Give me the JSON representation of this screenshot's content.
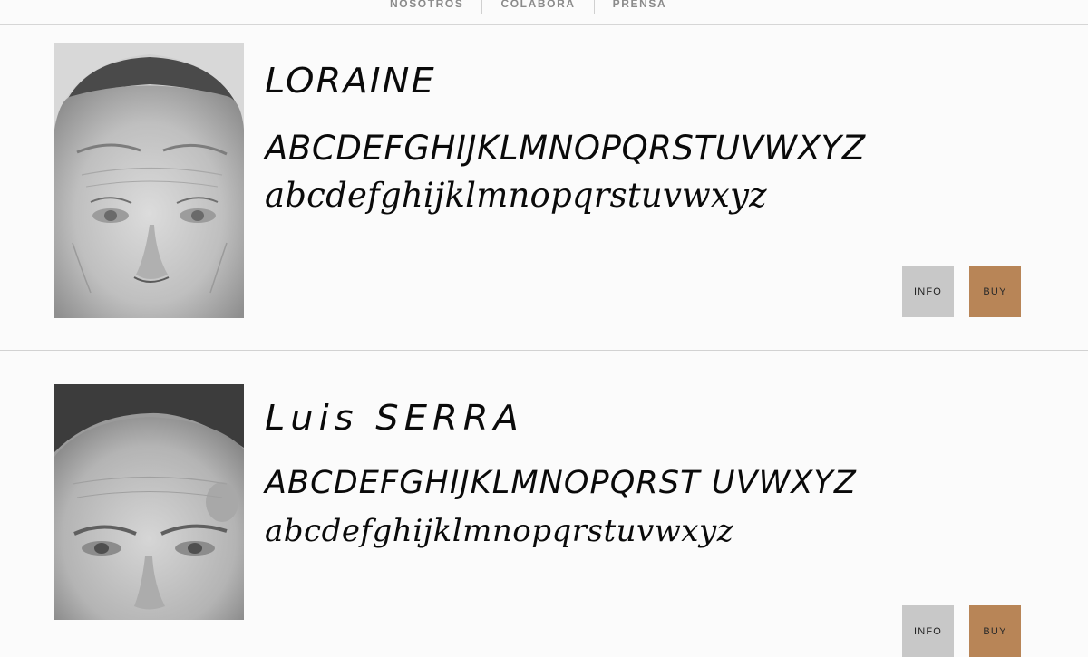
{
  "nav": {
    "items": [
      {
        "label": "NOSOTROS"
      },
      {
        "label": "COLABORA"
      },
      {
        "label": "PRENSA"
      }
    ]
  },
  "fonts": [
    {
      "name": "LORAINE",
      "uppercase": "ABCDEFGHIJKLMNOPQRSTUVWXYZ",
      "lowercase": "abcdefghijklmnopqrstuvwxyz",
      "info_label": "INFO",
      "buy_label": "BUY"
    },
    {
      "name": "Luis SERRA",
      "uppercase": "ABCDEFGHIJKLMNOPQRST UVWXYZ",
      "lowercase": "abcdefghijklmnopqrstuvwxyz",
      "info_label": "INFO",
      "buy_label": "BUY"
    }
  ],
  "colors": {
    "background": "#fbfbfb",
    "info_button": "#c8c8c8",
    "buy_button": "#b88557",
    "nav_text": "#8a8a8a"
  }
}
